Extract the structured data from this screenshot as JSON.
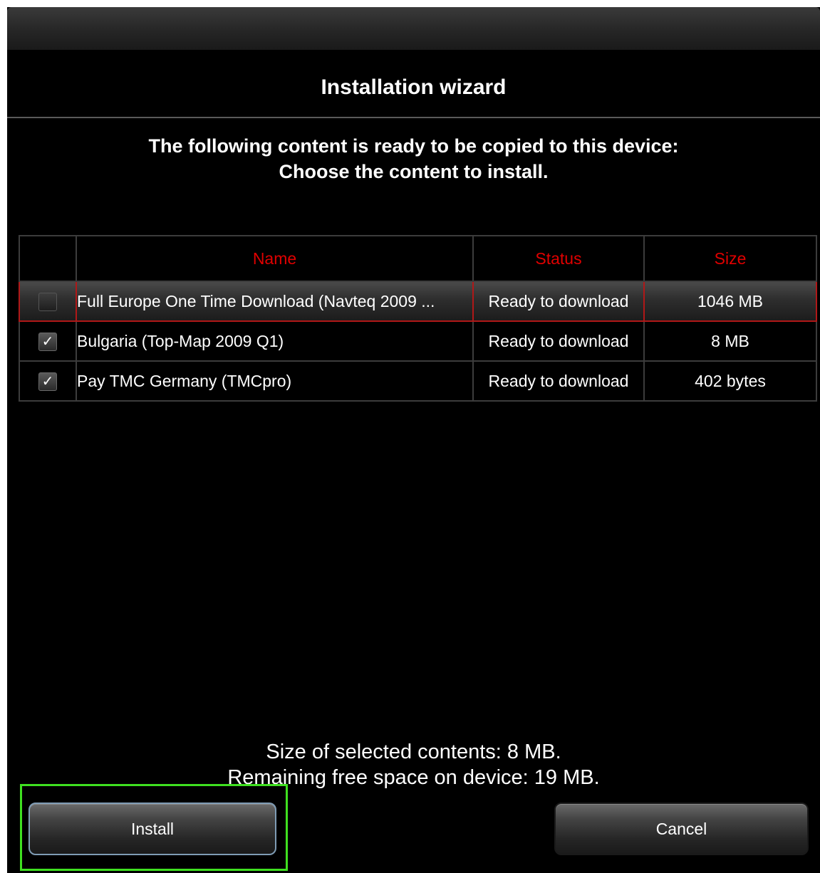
{
  "dialog": {
    "title": "Installation wizard",
    "prompt_line1": "The following content is ready to be copied to this device:",
    "prompt_line2": "Choose the content to install."
  },
  "table": {
    "columns": [
      "",
      "Name",
      "Status",
      "Size"
    ],
    "rows": [
      {
        "checked": false,
        "name": "Full Europe One Time Download (Navteq 2009 ...",
        "status": "Ready to download",
        "size": "1046 MB",
        "highlighted": true
      },
      {
        "checked": true,
        "name": "Bulgaria (Top-Map 2009 Q1)",
        "status": "Ready to download",
        "size": "8 MB",
        "highlighted": false
      },
      {
        "checked": true,
        "name": "Pay TMC Germany (TMCpro)",
        "status": "Ready to download",
        "size": "402 bytes",
        "highlighted": false
      }
    ],
    "check_glyph": "✓"
  },
  "summary": {
    "selected_size": "Size of selected contents: 8 MB.",
    "free_space": "Remaining free space on device: 19 MB."
  },
  "buttons": {
    "install_label": "Install",
    "cancel_label": "Cancel"
  },
  "colors": {
    "header_text": "#e00000",
    "selection_border": "#b01818",
    "focus_ring": "#3fe020"
  }
}
